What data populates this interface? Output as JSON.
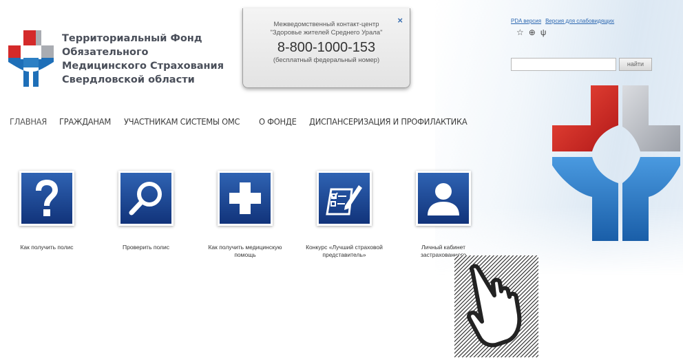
{
  "header": {
    "org_name_lines": [
      "Территориальный Фонд",
      "Обязательного",
      "Медицинского Страхования",
      "Свердловской области"
    ]
  },
  "popup": {
    "line1": "Межведомственный контакт-центр",
    "line2": "\"Здоровье жителей Среднего Урала\"",
    "phone": "8-800-1000-153",
    "note": "(бесплатный федеральный номер)",
    "close": "×"
  },
  "toplinks": [
    "PDA версия",
    "Версия для слабовидящих"
  ],
  "icons_row": [
    "star-icon",
    "globe-icon",
    "accessibility-icon"
  ],
  "search": {
    "placeholder": "",
    "button": "найти"
  },
  "nav": [
    "ГЛАВНАЯ",
    "ГРАЖДАНАМ",
    "УЧАСТНИКАМ СИСТЕМЫ ОМС",
    "О ФОНДЕ",
    "ДИСПАНСЕРИЗАЦИЯ И ПРОФИЛАКТИКА"
  ],
  "tiles": [
    {
      "label": "Как получить полис",
      "icon": "question-icon"
    },
    {
      "label": "Проверить полис",
      "icon": "magnifier-icon"
    },
    {
      "label": "Как получить медицинскую помощь",
      "icon": "cross-icon"
    },
    {
      "label": "Конкурс «Лучший страховой представитель»",
      "icon": "checklist-icon"
    },
    {
      "label": "Личный кабинет застрахованного",
      "icon": "user-icon"
    }
  ],
  "colors": {
    "brand_red": "#d42a2a",
    "brand_blue": "#1e6fb8",
    "brand_gray": "#a9acb2",
    "tile_blue": "#1c4a99",
    "link": "#2a66b0"
  }
}
